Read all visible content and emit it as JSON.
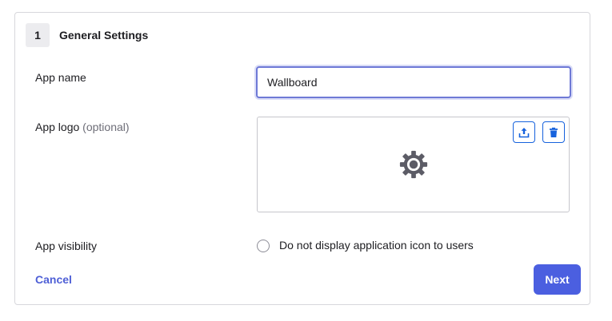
{
  "section": {
    "step_number": "1",
    "title": "General Settings"
  },
  "fields": {
    "app_name_label": "App name",
    "app_name_value": "Wallboard",
    "app_logo_label": "App logo",
    "app_logo_optional": "(optional)",
    "app_visibility_label": "App visibility",
    "visibility_checkbox_label": "Do not display application icon to users",
    "visibility_checked": false
  },
  "icons": {
    "upload": "upload-icon",
    "delete": "trash-icon",
    "placeholder_logo": "gear-icon"
  },
  "actions": {
    "cancel_label": "Cancel",
    "next_label": "Next"
  },
  "colors": {
    "accent": "#4b5fe0",
    "link": "#4e5fd6",
    "icon_button_border": "#1662dd",
    "focus_ring": "#6e79d6"
  }
}
